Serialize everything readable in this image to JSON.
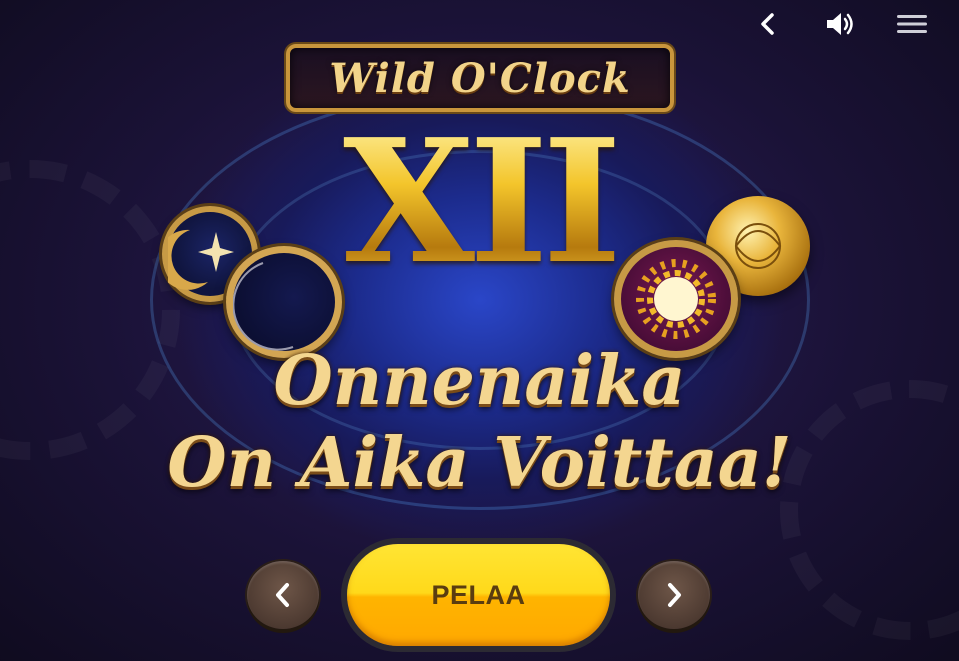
{
  "game": {
    "logo_text": "Wild O'Clock",
    "numeral": "XII",
    "headline_line1": "Onnenaika",
    "headline_line2": "On Aika Voittaa!"
  },
  "top_bar": {
    "back_icon": "chevron-left-icon",
    "sound_icon": "speaker-icon",
    "menu_icon": "hamburger-menu-icon"
  },
  "controls": {
    "play_label": "PELAA",
    "prev_icon": "chevron-left-icon",
    "next_icon": "chevron-right-icon"
  },
  "colors": {
    "play_button": "#ffd91a",
    "nav_button": "#4d3a31",
    "gold_text": "#f4d690"
  }
}
